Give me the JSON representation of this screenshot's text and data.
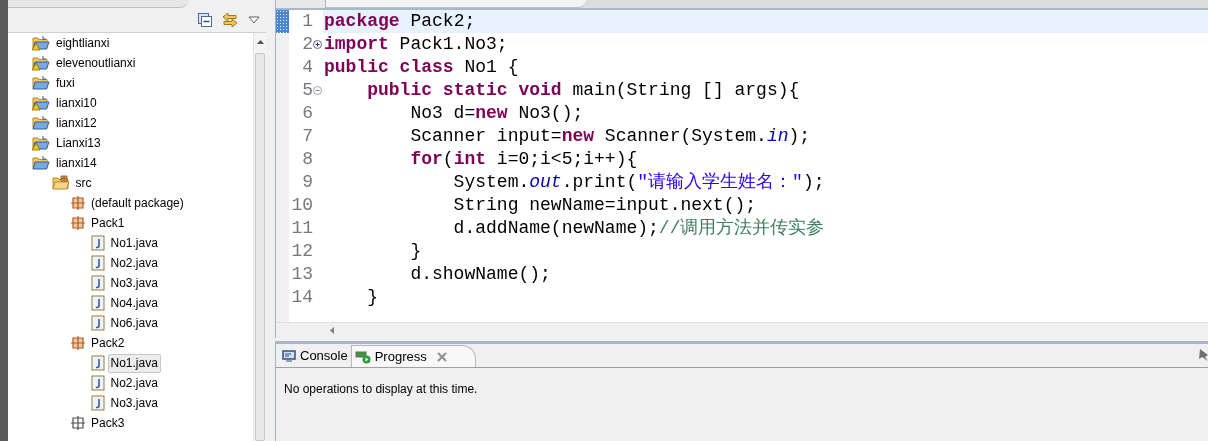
{
  "explorer": {
    "tree": [
      {
        "label": "eightlianxi",
        "kind": "project",
        "warning": true,
        "selected": false
      },
      {
        "label": "elevenoutlianxi",
        "kind": "project",
        "warning": true,
        "selected": false
      },
      {
        "label": "fuxi",
        "kind": "project",
        "warning": false,
        "selected": false
      },
      {
        "label": "lianxi10",
        "kind": "project",
        "warning": true,
        "selected": false
      },
      {
        "label": "lianxi12",
        "kind": "project",
        "warning": false,
        "selected": false
      },
      {
        "label": "Lianxi13",
        "kind": "project",
        "warning": true,
        "selected": false
      },
      {
        "label": "lianxi14",
        "kind": "project",
        "warning": false,
        "selected": false,
        "children": [
          {
            "label": "src",
            "kind": "source-folder",
            "selected": false,
            "children": [
              {
                "label": "(default package)",
                "kind": "package",
                "empty": false,
                "selected": false
              },
              {
                "label": "Pack1",
                "kind": "package",
                "empty": false,
                "selected": false,
                "children": [
                  {
                    "label": "No1.java",
                    "kind": "file",
                    "selected": false
                  },
                  {
                    "label": "No2.java",
                    "kind": "file",
                    "selected": false
                  },
                  {
                    "label": "No3.java",
                    "kind": "file",
                    "selected": false
                  },
                  {
                    "label": "No4.java",
                    "kind": "file",
                    "selected": false
                  },
                  {
                    "label": "No6.java",
                    "kind": "file",
                    "selected": false
                  }
                ]
              },
              {
                "label": "Pack2",
                "kind": "package",
                "empty": false,
                "selected": false,
                "children": [
                  {
                    "label": "No1.java",
                    "kind": "file",
                    "selected": true
                  },
                  {
                    "label": "No2.java",
                    "kind": "file",
                    "selected": false
                  },
                  {
                    "label": "No3.java",
                    "kind": "file",
                    "selected": false
                  }
                ]
              },
              {
                "label": "Pack3",
                "kind": "package",
                "empty": true,
                "selected": false
              }
            ]
          }
        ]
      }
    ]
  },
  "editor": {
    "lines": [
      {
        "number": "1",
        "current": true,
        "tokens": [
          {
            "kind": "keyword",
            "text": "package"
          },
          {
            "kind": "plain",
            "text": " Pack2;"
          }
        ]
      },
      {
        "number": "2",
        "collapsed": true,
        "current": false,
        "tokens": [
          {
            "kind": "keyword",
            "text": "import"
          },
          {
            "kind": "plain",
            "text": " Pack1.No3;"
          }
        ]
      },
      {
        "number": "4",
        "current": false,
        "tokens": [
          {
            "kind": "keyword",
            "text": "public"
          },
          {
            "kind": "keyword",
            "text": " class"
          },
          {
            "kind": "plain",
            "text": " No1 {"
          }
        ]
      },
      {
        "number": "5",
        "collapsed": false,
        "current": false,
        "tokens": [
          {
            "kind": "keyword",
            "text": "    public"
          },
          {
            "kind": "keyword",
            "text": " static"
          },
          {
            "kind": "keyword",
            "text": " void"
          },
          {
            "kind": "plain",
            "text": " main(String [] args){"
          }
        ]
      },
      {
        "number": "6",
        "current": false,
        "tokens": [
          {
            "kind": "plain",
            "text": "        No3 d="
          },
          {
            "kind": "keyword",
            "text": "new"
          },
          {
            "kind": "plain",
            "text": " No3();"
          }
        ]
      },
      {
        "number": "7",
        "current": false,
        "tokens": [
          {
            "kind": "plain",
            "text": "        Scanner input="
          },
          {
            "kind": "keyword",
            "text": "new"
          },
          {
            "kind": "plain",
            "text": " Scanner(System."
          },
          {
            "kind": "field",
            "text": "in"
          },
          {
            "kind": "plain",
            "text": ");"
          }
        ]
      },
      {
        "number": "8",
        "current": false,
        "tokens": [
          {
            "kind": "keyword",
            "text": "        for"
          },
          {
            "kind": "plain",
            "text": "("
          },
          {
            "kind": "keyword",
            "text": "int"
          },
          {
            "kind": "plain",
            "text": " i=0;i<5;i++){"
          }
        ]
      },
      {
        "number": "9",
        "current": false,
        "tokens": [
          {
            "kind": "plain",
            "text": "            System."
          },
          {
            "kind": "field",
            "text": "out"
          },
          {
            "kind": "plain",
            "text": ".print("
          },
          {
            "kind": "string",
            "text": "\"请输入学生姓名：\""
          },
          {
            "kind": "plain",
            "text": ");"
          }
        ]
      },
      {
        "number": "10",
        "current": false,
        "tokens": [
          {
            "kind": "plain",
            "text": "            String newName=input.next();"
          }
        ]
      },
      {
        "number": "11",
        "current": false,
        "tokens": [
          {
            "kind": "plain",
            "text": "            d.addName(newName);"
          },
          {
            "kind": "comment",
            "text": "//调用方法并传实参"
          }
        ]
      },
      {
        "number": "12",
        "current": false,
        "tokens": [
          {
            "kind": "plain",
            "text": "        }"
          }
        ]
      },
      {
        "number": "13",
        "current": false,
        "tokens": [
          {
            "kind": "plain",
            "text": "        d.showName();"
          }
        ]
      },
      {
        "number": "14",
        "current": false,
        "tokens": [
          {
            "kind": "plain",
            "text": "    }"
          }
        ]
      }
    ]
  },
  "bottom_panel": {
    "tabs": [
      {
        "label": "Console",
        "kind": "console",
        "selected": false,
        "closable": false
      },
      {
        "label": "Progress",
        "kind": "progress",
        "selected": true,
        "closable": true
      }
    ],
    "message": "No operations to display at this time."
  }
}
